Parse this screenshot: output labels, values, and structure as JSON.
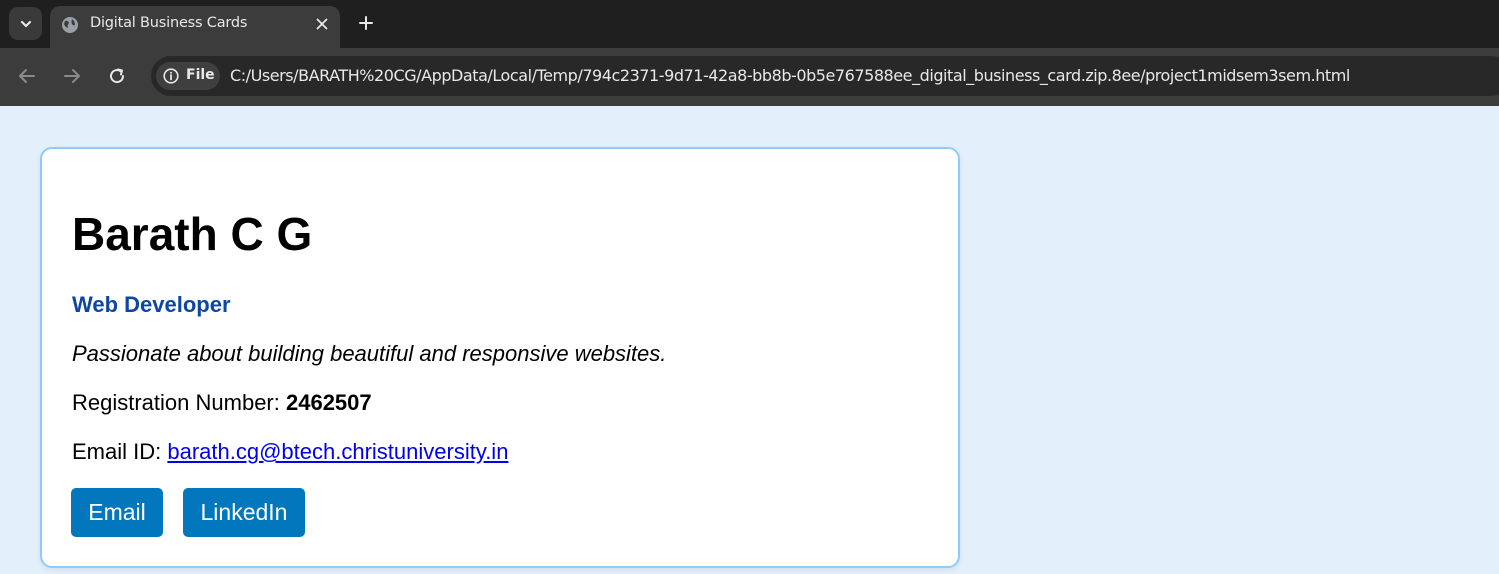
{
  "browser": {
    "tab_title": "Digital Business Cards",
    "security_chip": "File",
    "url": "C:/Users/BARATH%20CG/AppData/Local/Temp/794c2371-9d71-42a8-bb8b-0b5e767588ee_digital_business_card.zip.8ee/project1midsem3sem.html",
    "icons": [
      "tab-search-icon",
      "globe-icon",
      "close-icon",
      "plus-icon",
      "back-arrow-icon",
      "forward-arrow-icon",
      "reload-icon",
      "info-icon"
    ]
  },
  "card": {
    "name": "Barath C G",
    "role": "Web Developer",
    "tagline": "Passionate about building beautiful and responsive websites.",
    "registration_label": "Registration Number: ",
    "registration_number": "2462507",
    "email_label": "Email ID: ",
    "email": "barath.cg@btech.christuniversity.in",
    "buttons": {
      "email": "Email",
      "linkedin": "LinkedIn"
    }
  },
  "colors": {
    "page_background": "#e3f0fb",
    "card_border": "#90caf9",
    "role_text": "#0d47a1",
    "button_background": "#0277bd",
    "link": "#0000ee"
  }
}
